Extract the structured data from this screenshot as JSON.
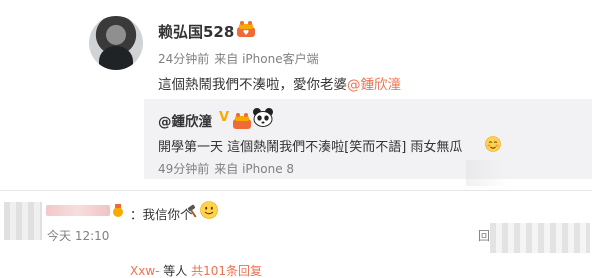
{
  "post": {
    "username": "赖弘国528",
    "time": "24分钟前",
    "source": "来自 iPhone客户端",
    "text": "這個熱鬧我們不湊啦，愛你老婆",
    "mention": "@鍾欣潼"
  },
  "repost": {
    "username": "@鍾欣潼",
    "vip_mark": "V",
    "text": "開學第一天 這個熱鬧我們不湊啦[笑而不語] 雨女無瓜",
    "time": "49分钟前",
    "source": "来自 iPhone 8"
  },
  "comment": {
    "text": "：我信你个",
    "time": "今天 12:10",
    "reply_partial": "回",
    "sub_reply_user": "Xxw-",
    "sub_reply_mid": " 等人 ",
    "sub_reply_link": "共101条回复"
  },
  "icons": {
    "badge": "cake-badge-icon",
    "panda": "panda-icon",
    "emoji_blush": "blush-emoji-icon",
    "hammer": "hammer-icon",
    "smile": "smile-emoji-icon"
  },
  "colors": {
    "link": "#eb7350",
    "vip": "#f7ab00",
    "meta": "#808080",
    "repost_bg": "#f2f2f5"
  }
}
